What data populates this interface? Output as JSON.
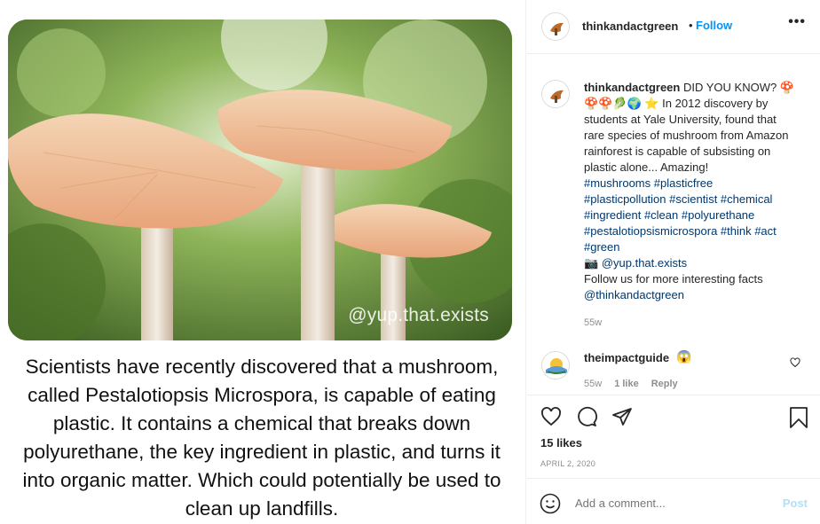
{
  "post": {
    "watermark": "@yup.that.exists",
    "image_text": "Scientists have recently discovered that a mushroom, called Pestalotiopsis Microspora, is capable of eating plastic. It contains a chemical that breaks down polyurethane, the key ingredient in plastic, and turns it into organic matter. Which could potentially be used to clean up landfills."
  },
  "header": {
    "username": "thinkandactgreen",
    "separator": "•",
    "follow_label": "Follow",
    "more_label": "•••"
  },
  "caption": {
    "username": "thinkandactgreen",
    "line_a": "DID YOU KNOW?",
    "emojis": "🍄🍄🍄🥬🌍 ⭐",
    "line_b": "In 2012 discovery by students at Yale University, found that rare species of mushroom from Amazon rainforest is capable of subsisting on plastic alone... Amazing!",
    "hashtags": "#mushrooms #plasticfree #plasticpollution #scientist #chemical #ingredient #clean #polyurethane #pestalotiopsismicrospora #think #act #green",
    "camera": "📷",
    "credit": "@yup.that.exists",
    "follow_line": "Follow us for more interesting facts",
    "mention": "@thinkandactgreen",
    "time": "55w"
  },
  "reply": {
    "username": "theimpactguide",
    "emoji": "😱",
    "time": "55w",
    "likes": "1 like",
    "reply_label": "Reply"
  },
  "actions": {
    "likes": "15 likes",
    "date": "APRIL 2, 2020"
  },
  "composer": {
    "placeholder": "Add a comment...",
    "post_label": "Post"
  }
}
